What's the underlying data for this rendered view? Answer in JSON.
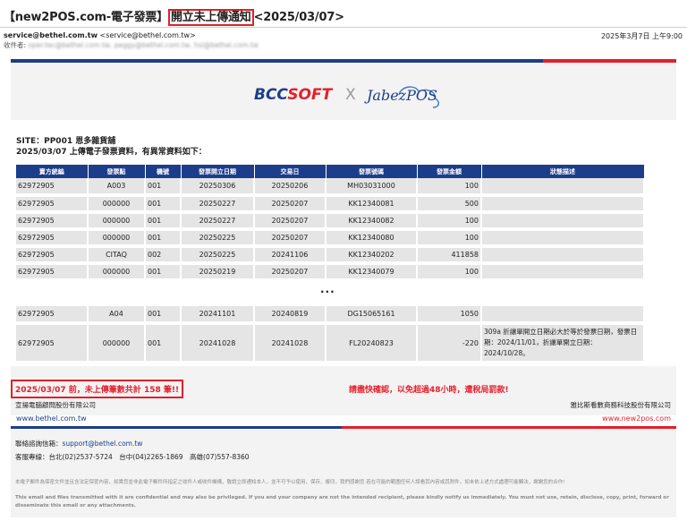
{
  "email": {
    "subject_pre": "【new2POS.com-電子發票】",
    "subject_hl": "開立未上傳通知",
    "subject_post": "<2025/03/07>",
    "sender_email": "service@bethel.com.tw",
    "sender_addr": "<service@bethel.com.tw>",
    "date": "2025年3月7日 上午9:00",
    "recipients_label": "收件者:",
    "recipients": "oper.tec@bethel.com.tw, peggy@bethel.com.tw, hsi@bethel.com.tw"
  },
  "banner": {
    "bcc_part1": "BCC",
    "bcc_part2": "SOFT",
    "x": "X",
    "jabez": "JabezPOS"
  },
  "report": {
    "site": "SITE：PP001 恩多雜貨舖",
    "intro": "2025/03/07 上傳電子發票資料，有異常資料如下："
  },
  "table": {
    "headers": [
      "賣方統編",
      "發票點",
      "機號",
      "發票開立日期",
      "交易日",
      "發票號碼",
      "發票金額",
      "狀態描述"
    ],
    "rows": [
      [
        "62972905",
        "A003",
        "001",
        "20250306",
        "20250206",
        "MH03031000",
        "100",
        ""
      ],
      [
        "62972905",
        "000000",
        "001",
        "20250227",
        "20250207",
        "KK12340081",
        "500",
        ""
      ],
      [
        "62972905",
        "000000",
        "001",
        "20250227",
        "20250207",
        "KK12340082",
        "100",
        ""
      ],
      [
        "62972905",
        "000000",
        "001",
        "20250225",
        "20250207",
        "KK12340080",
        "100",
        ""
      ],
      [
        "62972905",
        "CITAQ",
        "002",
        "20250225",
        "20241106",
        "KK12340202",
        "411858",
        ""
      ],
      [
        "62972905",
        "000000",
        "001",
        "20250219",
        "20250207",
        "KK12340079",
        "100",
        ""
      ]
    ],
    "ellipsis": "...",
    "rows2": [
      [
        "62972905",
        "A04",
        "001",
        "20241101",
        "20240819",
        "DG15065161",
        "1050",
        ""
      ],
      [
        "62972905",
        "000000",
        "001",
        "20241028",
        "20241028",
        "FL20240823",
        "-220",
        "309a 折讓單開立日期必大於等於發票日期，發票日期：2024/11/01，折讓單開立日期：2024/10/28。"
      ]
    ]
  },
  "summary": {
    "count_text": "2025/03/07 前，未上傳筆數共計 158 筆!!",
    "warning": "請盡快確認，以免超過48小時，遭稅局罰款!",
    "company_left": "宣揚電腦顧問股份有限公司",
    "company_right": "雅比斯看數商務科技股份有限公司",
    "web_left": "www.bethel.com.tw",
    "web_right": "www.new2pos.com"
  },
  "footer": {
    "contact_label": "聯絡諮詢信箱：",
    "contact_email": "support@bethel.com.tw",
    "hotline": "客服專線：台北(02)2537-5724　台中(04)2265-1869　高雄(07)557-8360",
    "disclaimer_zh": "本電子郵件為保密文件並且含法定保密內容，如貴您並非此電子郵件所指定之收件人或收件機構，敬請立即通知本人，並不可予以使用、保存、複印，我們感謝您 若在可能的範圍任何人誤看其內容或其附件，如未依上述方式處理可能觸法，謝謝您的合作!",
    "disclaimer_en": "This email and files transmitted with it are confidential and may also be privileged. If you and your company are not the intended recipient, please kindly notify us immediately. You must not use, retain, disclose, copy, print, forward or disseminate this email or any attachments."
  },
  "colors": {
    "brand_blue": "#1c3d8a",
    "brand_red": "#e41f2b"
  }
}
